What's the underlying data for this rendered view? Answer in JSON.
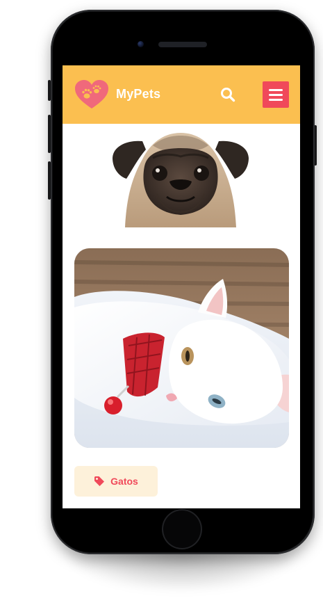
{
  "app": {
    "title": "MyPets",
    "brand_color": "#fbbf50",
    "accent_color": "#f0495a"
  },
  "header": {
    "logo_icon": "heart-paw-icon",
    "search_icon": "search-icon",
    "menu_icon": "hamburger-menu-icon"
  },
  "content": {
    "images": [
      {
        "subject": "pug-dog-photo"
      },
      {
        "subject": "white-cat-photo"
      }
    ],
    "tag": {
      "icon": "tag-icon",
      "label": "Gatos"
    }
  }
}
